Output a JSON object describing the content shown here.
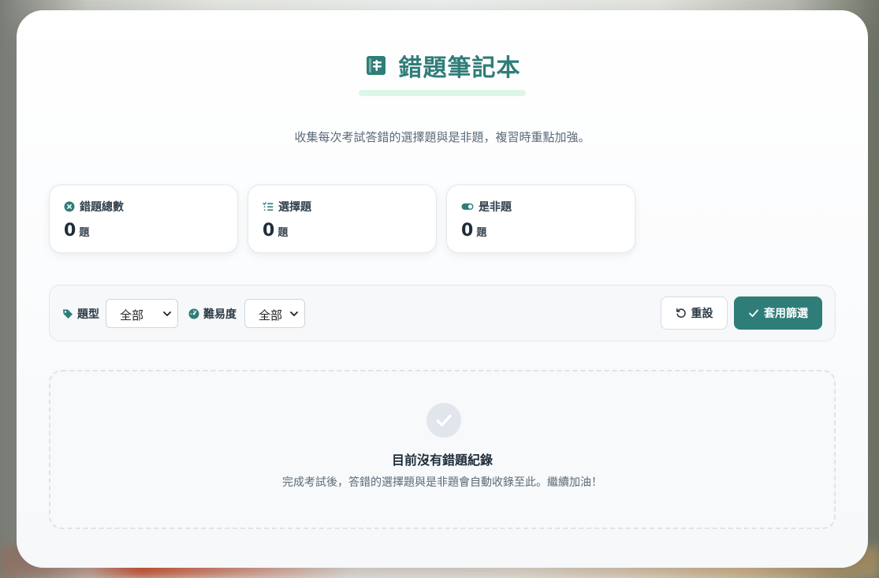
{
  "header": {
    "title": "錯題筆記本",
    "subtitle": "收集每次考試答錯的選擇題與是非題，複習時重點加強。"
  },
  "stats": [
    {
      "label": "錯題總數",
      "value": "0",
      "unit": "題",
      "icon": "x-circle-icon"
    },
    {
      "label": "選擇題",
      "value": "0",
      "unit": "題",
      "icon": "list-check-icon"
    },
    {
      "label": "是非題",
      "value": "0",
      "unit": "題",
      "icon": "toggle-icon"
    }
  ],
  "filters": {
    "type_label": "題型",
    "type_value": "全部",
    "difficulty_label": "難易度",
    "difficulty_value": "全部",
    "reset_label": "重設",
    "apply_label": "套用篩選"
  },
  "empty_state": {
    "title": "目前沒有錯題紀錄",
    "description": "完成考試後，答錯的選擇題與是非題會自動收錄至此。繼續加油！"
  },
  "colors": {
    "accent": "#2f7d78",
    "accent_light": "#dcf7e7",
    "text_dark": "#1f2d3a",
    "text_muted": "#5c6b78"
  }
}
